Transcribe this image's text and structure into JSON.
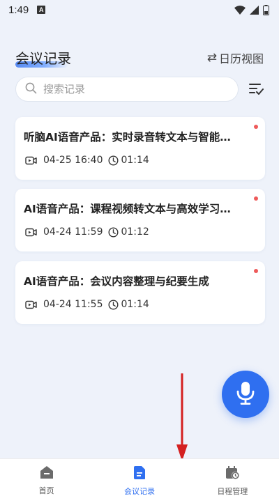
{
  "status_bar": {
    "time": "1:49",
    "notification_letter": "A"
  },
  "header": {
    "title": "会议记录",
    "calendar_view_label": "日历视图",
    "swap_symbol": "⇄"
  },
  "search": {
    "placeholder": "搜索记录"
  },
  "records": [
    {
      "title": "听脑AI语音产品：实时录音转文本与智能…",
      "date": "04-25 16:40",
      "duration": "01:14",
      "unread": true
    },
    {
      "title": "AI语音产品：课程视频转文本与高效学习…",
      "date": "04-24 11:59",
      "duration": "01:12",
      "unread": true
    },
    {
      "title": "AI语音产品：会议内容整理与纪要生成",
      "date": "04-24 11:55",
      "duration": "01:14",
      "unread": true
    }
  ],
  "bottom_nav": [
    {
      "label": "首页",
      "icon": "home-icon",
      "active": false
    },
    {
      "label": "会议记录",
      "icon": "document-icon",
      "active": true
    },
    {
      "label": "日程管理",
      "icon": "calendar-clock-icon",
      "active": false
    }
  ],
  "colors": {
    "accent": "#2f6ff0",
    "unread_dot": "#ee5a5a",
    "annotation_arrow": "#d42020",
    "background": "#eef2fa"
  }
}
